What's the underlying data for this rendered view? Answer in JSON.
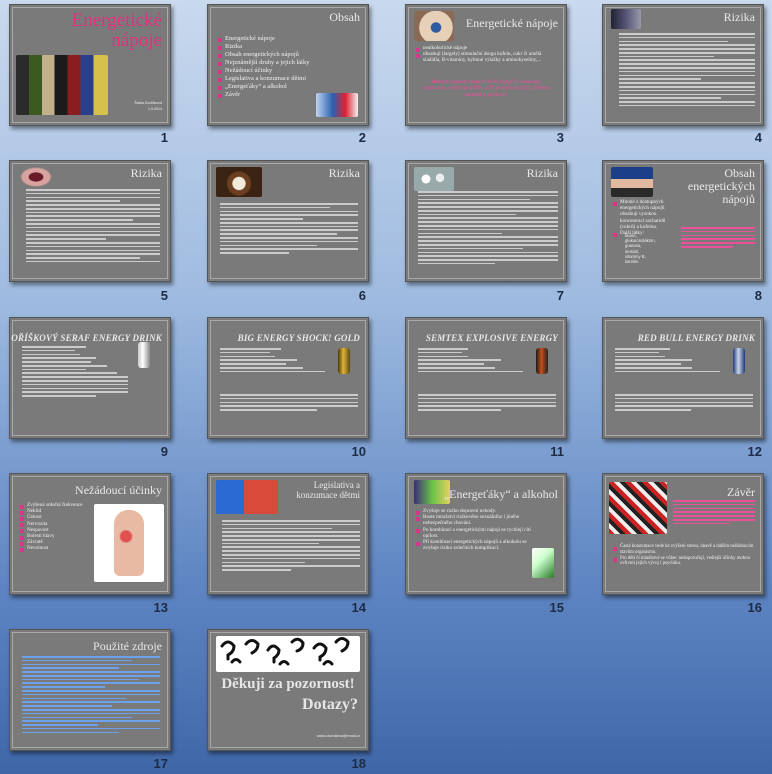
{
  "slides": [
    {
      "num": "1",
      "title": "Energetické nápoje",
      "author": "Šárka Dvořáková",
      "date": "1.9.2014"
    },
    {
      "num": "2",
      "title": "Obsah",
      "items": [
        "Energetické nápoje",
        "Rizika",
        "Obsah energetických nápojů",
        "Nejznámější druhy a jejich látky",
        "Nežádoucí účinky",
        "Legislativa a konzumace dětmi",
        "„Energeťáky“ a alkohol",
        "Závěr"
      ]
    },
    {
      "num": "3",
      "title": "Energetické nápoje",
      "items": [
        "nealkoholické nápoje",
        "obsahují (largely) stimulační drogu kofein, cukr či umělá sladidla, B-vitamíny, bylinné výtažky a aminokyseliny,..."
      ],
      "pink": "Hlavním zájmem energetických nápojů je stimulace organismu, a proto jsou lidé, kteří je nejčastěji pijí, většinou studenti a sportovci."
    },
    {
      "num": "4",
      "title": "Rizika"
    },
    {
      "num": "5",
      "title": "Rizika"
    },
    {
      "num": "6",
      "title": "Rizika"
    },
    {
      "num": "7",
      "title": "Rizika"
    },
    {
      "num": "8",
      "title": "Obsah energetických nápojů",
      "items": [
        "Mnohé z dostupných energetických nápojů obsahují vysokou koncentraci sacharidů (cukrů) a kofeinu.",
        "Další látky:"
      ],
      "sub": [
        "taurin,",
        "glukuronolakton,",
        "guarana,",
        "inositol,",
        "vitamíny B,",
        "karnitin"
      ]
    },
    {
      "num": "9",
      "title": "Oříškový Seraf energy drink"
    },
    {
      "num": "10",
      "title": "Big energy shock! Gold"
    },
    {
      "num": "11",
      "title": "Semtex explosive energy"
    },
    {
      "num": "12",
      "title": "Red Bull energy drink"
    },
    {
      "num": "13",
      "title": "Nežádoucí účinky",
      "items": [
        "Zvýšená srdeční frekvence",
        "Neklid",
        "Úzkost",
        "Nervozita",
        "Nespavost",
        "Bolesti hlavy",
        "Závratě",
        "Nevolnost"
      ]
    },
    {
      "num": "14",
      "title": "Legislativa a konzumace dětmi"
    },
    {
      "num": "15",
      "title": "„Energeťáky“ a alkohol",
      "items": [
        "Zvyšuje se riziko dopravní nehody.",
        "Roste množství rizikového sexuálního i jiného nebezpečného chování.",
        "Po kombinaci s energetickými nápoji se rychleji cítí opilost.",
        "Při kombinaci energetických nápojů a alkoholu se zvyšuje riziko srdečních komplikací."
      ]
    },
    {
      "num": "16",
      "title": "Závěr",
      "items": [
        "Častá konzumace vede ke zvýšení stresu, únavě a dalším nežádoucím stavům organismu.",
        "Pro děti či mladistvé se vůbec nedoporučují, vedlejší účinky mohou ovlivnit jejich vývoj i psychiku."
      ]
    },
    {
      "num": "17",
      "title": "Použité zdroje"
    },
    {
      "num": "18",
      "title": "Děkuji za pozornost!",
      "subtitle": "Dotazy?",
      "email": "sarka.dvorakova@email.cz"
    }
  ],
  "colors": {
    "accent": "#d8368a",
    "slide_bg": "#7a7a7a",
    "bg_top": "#c9d9ee",
    "bg_bottom": "#3f67a8"
  }
}
